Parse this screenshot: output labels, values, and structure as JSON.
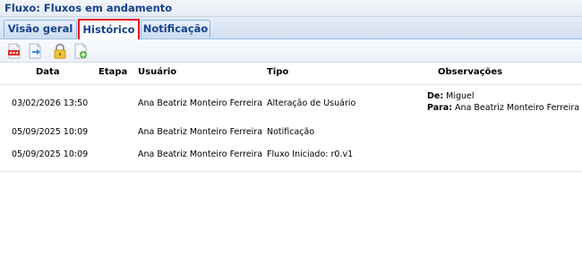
{
  "window": {
    "title": "Fluxo: Fluxos em andamento"
  },
  "tabs": [
    {
      "label": "Visão geral"
    },
    {
      "label": "Histórico"
    },
    {
      "label": "Notificação"
    }
  ],
  "toolbar": {
    "buttons": [
      {
        "icon": "pdf-icon"
      },
      {
        "icon": "export-icon"
      },
      {
        "icon": "lock-icon"
      },
      {
        "icon": "document-add-icon"
      }
    ]
  },
  "table": {
    "columns": [
      "Data",
      "Etapa",
      "Usuário",
      "Tipo",
      "Observações"
    ],
    "rows": [
      {
        "data": "03/02/2026 13:50",
        "etapa": "",
        "usuario": "Ana Beatriz Monteiro Ferreira",
        "tipo": "Alteração de Usuário",
        "obs_de_label": "De:",
        "obs_de_value": "Miguel",
        "obs_para_label": "Para:",
        "obs_para_value": "Ana Beatriz Monteiro Ferreira"
      },
      {
        "data": "05/09/2025 10:09",
        "etapa": "",
        "usuario": "Ana Beatriz Monteiro Ferreira",
        "tipo": "Notificação"
      },
      {
        "data": "05/09/2025 10:09",
        "etapa": "",
        "usuario": "Ana Beatriz Monteiro Ferreira",
        "tipo": "Fluxo Iniciado: r0.v1"
      }
    ]
  }
}
